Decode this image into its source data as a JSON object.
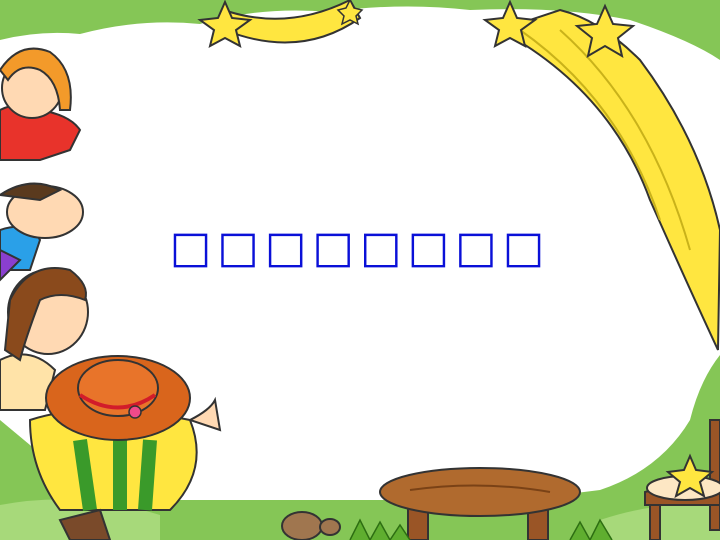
{
  "slide": {
    "title": "□□□□□□□□",
    "title_color": "#0a10d8"
  },
  "decor": {
    "icons": [
      "star-icon",
      "shooting-star-icon",
      "child-figure-icon",
      "straw-hat-icon",
      "table-icon",
      "chair-icon",
      "rock-icon"
    ],
    "colors": {
      "grass": "#7fc24a",
      "panel": "#ffffff",
      "star_yellow": "#ffe640",
      "wood": "#b06a2e"
    }
  }
}
